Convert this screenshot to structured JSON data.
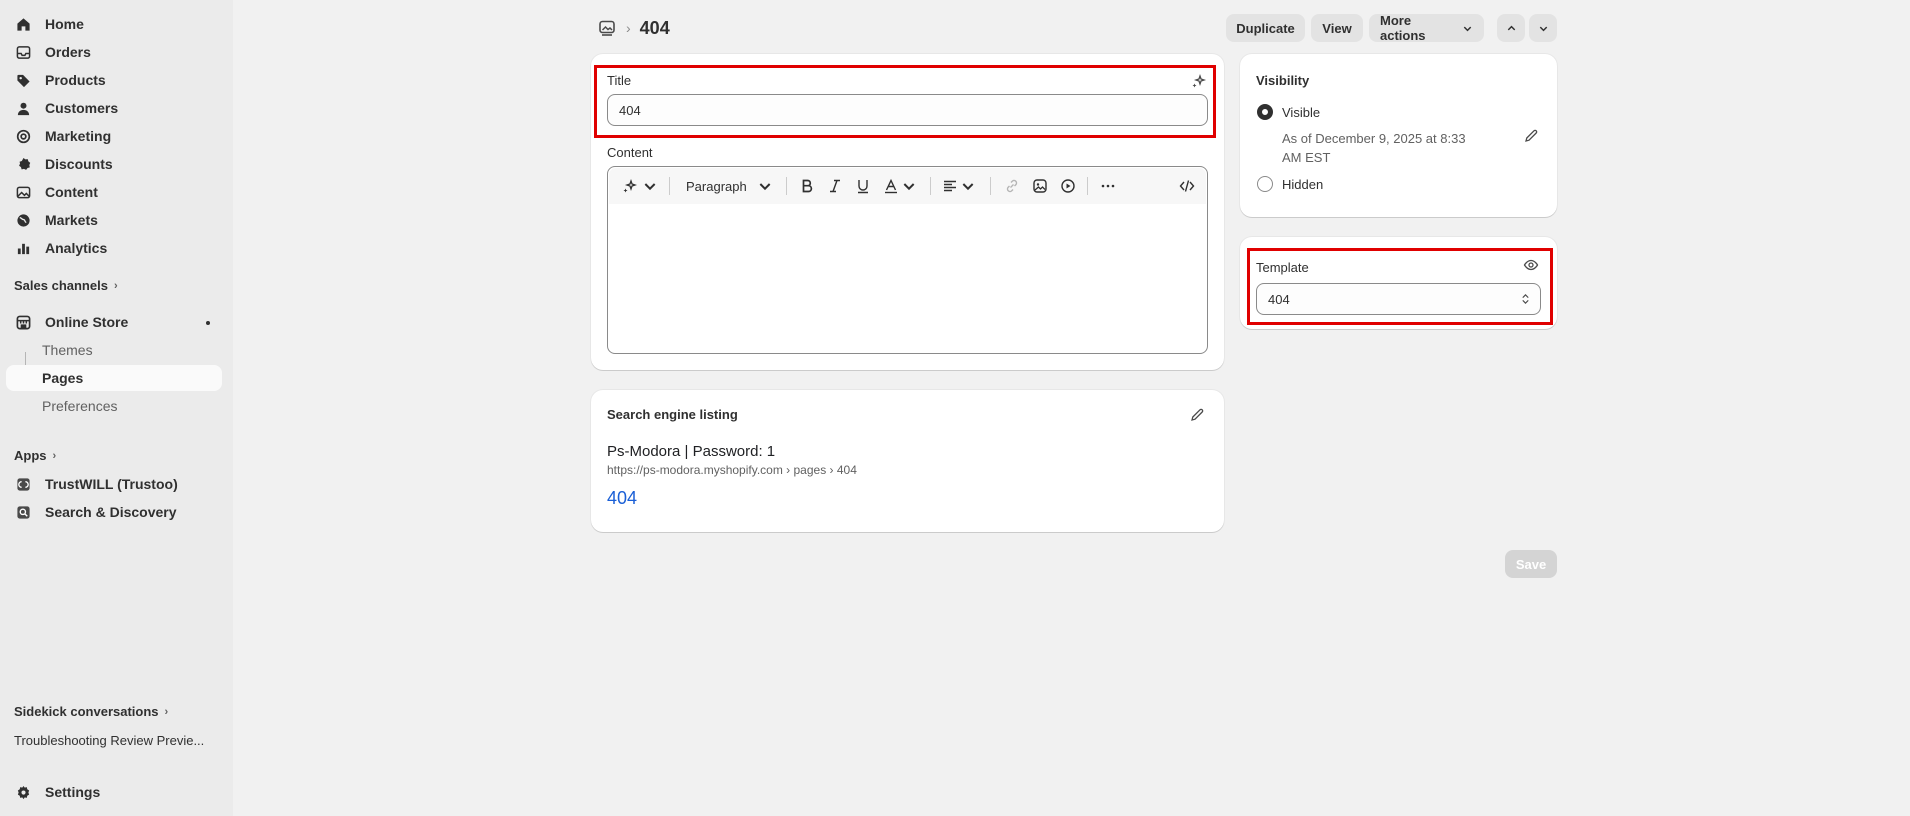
{
  "sidebar": {
    "items": [
      {
        "label": "Home",
        "icon": "home-icon"
      },
      {
        "label": "Orders",
        "icon": "inbox-icon"
      },
      {
        "label": "Products",
        "icon": "tag-icon"
      },
      {
        "label": "Customers",
        "icon": "person-icon"
      },
      {
        "label": "Marketing",
        "icon": "target-icon"
      },
      {
        "label": "Discounts",
        "icon": "discount-icon"
      },
      {
        "label": "Content",
        "icon": "image-icon"
      },
      {
        "label": "Markets",
        "icon": "globe-icon"
      },
      {
        "label": "Analytics",
        "icon": "bar-chart-icon"
      }
    ],
    "sales_channels_label": "Sales channels",
    "online_store": {
      "label": "Online Store",
      "sub": [
        "Themes",
        "Pages",
        "Preferences"
      ]
    },
    "apps_label": "Apps",
    "apps": [
      {
        "label": "TrustWILL (Trustoo)"
      },
      {
        "label": "Search & Discovery"
      }
    ],
    "sidekick_label": "Sidekick conversations",
    "sidekick_item": "Troubleshooting Review Previe...",
    "settings_label": "Settings"
  },
  "header": {
    "title": "404",
    "buttons": {
      "duplicate": "Duplicate",
      "view": "View",
      "more_actions": "More actions"
    }
  },
  "page_form": {
    "title_label": "Title",
    "title_value": "404",
    "content_label": "Content",
    "paragraph_select": "Paragraph"
  },
  "seo": {
    "heading": "Search engine listing",
    "site_title": "Ps-Modora | Password: 1",
    "url": "https://ps-modora.myshopify.com › pages › 404",
    "page_title": "404"
  },
  "visibility": {
    "heading": "Visibility",
    "visible_label": "Visible",
    "visible_date": "As of December 9, 2025 at 8:33 AM EST",
    "hidden_label": "Hidden",
    "selected": "Visible"
  },
  "template": {
    "heading": "Template",
    "value": "404"
  },
  "save_label": "Save",
  "colors": {
    "highlight": "#e00000",
    "link": "#1a5fd6",
    "active_nav_bg": "#fafafa"
  }
}
